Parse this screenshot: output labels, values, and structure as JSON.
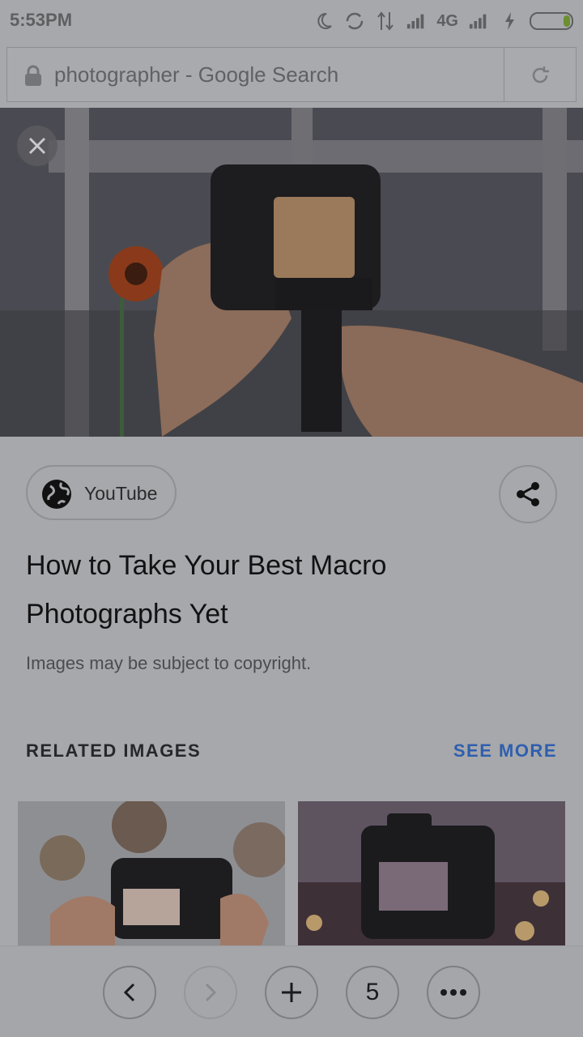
{
  "status_bar": {
    "time": "5:53PM",
    "network": "4G",
    "icons": [
      "moon-icon",
      "sync-icon",
      "data-arrows-icon",
      "signal-icon",
      "signal-icon",
      "charging-icon",
      "battery-icon"
    ]
  },
  "url_bar": {
    "text": "photographer - Google Search",
    "lock_icon": "lock-icon",
    "reload_icon": "reload-icon"
  },
  "hero": {
    "close_icon": "close-icon"
  },
  "source": {
    "name": "YouTube",
    "icon": "globe-icon"
  },
  "share": {
    "icon": "share-icon"
  },
  "result": {
    "title": "How to Take Your Best Macro Photographs Yet",
    "copyright": "Images may be subject to copyright."
  },
  "related": {
    "heading": "RELATED IMAGES",
    "see_more": "SEE MORE"
  },
  "bottom_nav": {
    "tab_count": "5",
    "icons": [
      "back-icon",
      "forward-icon",
      "new-tab-icon",
      "more-icon"
    ]
  },
  "colors": {
    "background": "#a7a8ab",
    "accent": "#2f5fae",
    "text_dark": "#121214"
  }
}
